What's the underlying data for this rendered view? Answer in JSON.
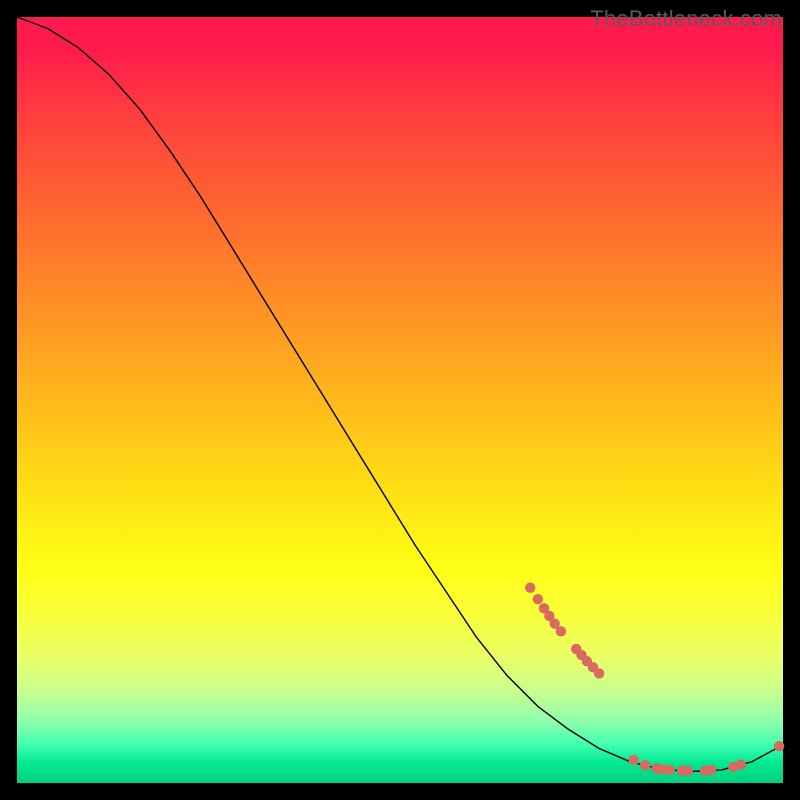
{
  "watermark": "TheBottleneck.com",
  "colors": {
    "background": "#000000",
    "curve_stroke": "#000000",
    "dot_fill": "#d86a62",
    "watermark_text": "#5a5a5a"
  },
  "chart_data": {
    "type": "line",
    "title": "",
    "xlabel": "",
    "ylabel": "",
    "xlim": [
      0,
      100
    ],
    "ylim": [
      0,
      100
    ],
    "grid": false,
    "legend": false,
    "series": [
      {
        "name": "curve",
        "x": [
          0,
          4,
          8,
          12,
          16,
          20,
          24,
          28,
          32,
          36,
          40,
          44,
          48,
          52,
          56,
          60,
          64,
          68,
          72,
          76,
          80,
          84,
          88,
          92,
          96,
          100
        ],
        "y": [
          100,
          98.5,
          96,
          92.5,
          88,
          82.5,
          76.5,
          70,
          63.5,
          57,
          50.5,
          44,
          37.5,
          31,
          25,
          19,
          14,
          10,
          7,
          4.5,
          2.8,
          1.8,
          1.5,
          1.7,
          2.8,
          5
        ]
      }
    ],
    "dots_cluster_a": {
      "name": "upper-dot-cluster",
      "points": [
        {
          "x": 67,
          "y": 25.5
        },
        {
          "x": 68,
          "y": 24.0
        },
        {
          "x": 68.8,
          "y": 22.8
        },
        {
          "x": 69.5,
          "y": 21.8
        },
        {
          "x": 70.2,
          "y": 20.8
        },
        {
          "x": 71.0,
          "y": 19.8
        },
        {
          "x": 73.0,
          "y": 17.5
        },
        {
          "x": 73.7,
          "y": 16.7
        },
        {
          "x": 74.4,
          "y": 15.9
        },
        {
          "x": 75.2,
          "y": 15.1
        },
        {
          "x": 76.0,
          "y": 14.3
        }
      ]
    },
    "dots_cluster_b": {
      "name": "valley-dot-cluster",
      "points": [
        {
          "x": 80.5,
          "y": 3.0
        },
        {
          "x": 82.0,
          "y": 2.3
        },
        {
          "x": 83.5,
          "y": 1.9
        },
        {
          "x": 84.2,
          "y": 1.8
        },
        {
          "x": 85.2,
          "y": 1.7
        },
        {
          "x": 86.8,
          "y": 1.6
        },
        {
          "x": 87.6,
          "y": 1.6
        },
        {
          "x": 89.8,
          "y": 1.6
        },
        {
          "x": 90.6,
          "y": 1.7
        },
        {
          "x": 93.5,
          "y": 2.1
        },
        {
          "x": 94.5,
          "y": 2.4
        }
      ]
    },
    "dots_end": {
      "name": "end-dot",
      "points": [
        {
          "x": 99.5,
          "y": 4.8
        }
      ]
    }
  }
}
